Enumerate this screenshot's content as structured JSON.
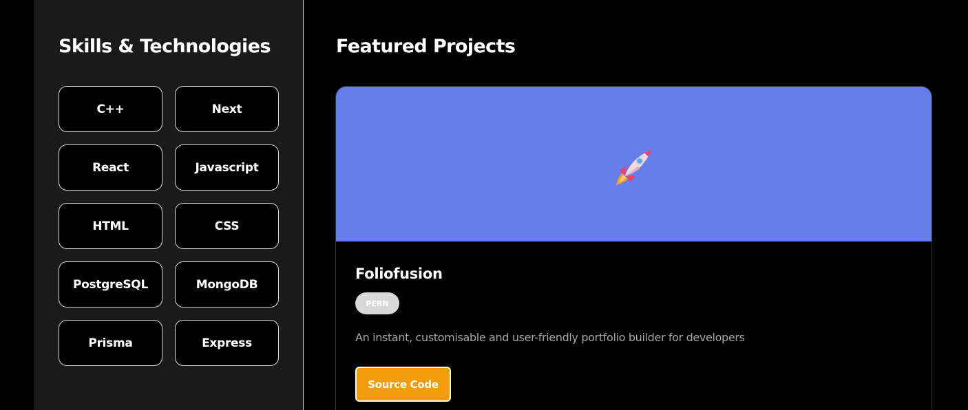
{
  "skills": {
    "title": "Skills & Technologies",
    "items": [
      {
        "label": "C++"
      },
      {
        "label": "Next"
      },
      {
        "label": "React"
      },
      {
        "label": "Javascript"
      },
      {
        "label": "HTML"
      },
      {
        "label": "CSS"
      },
      {
        "label": "PostgreSQL"
      },
      {
        "label": "MongoDB"
      },
      {
        "label": "Prisma"
      },
      {
        "label": "Express"
      }
    ]
  },
  "projects": {
    "title": "Featured Projects",
    "items": [
      {
        "banner_icon": "rocket-icon",
        "banner_color": "#667eea",
        "name": "Foliofusion",
        "stack_badge": "PERN",
        "description": "An instant, customisable and user-friendly portfolio builder for developers",
        "source_button_label": "Source Code",
        "source_button_color": "#f39c0c"
      }
    ]
  }
}
